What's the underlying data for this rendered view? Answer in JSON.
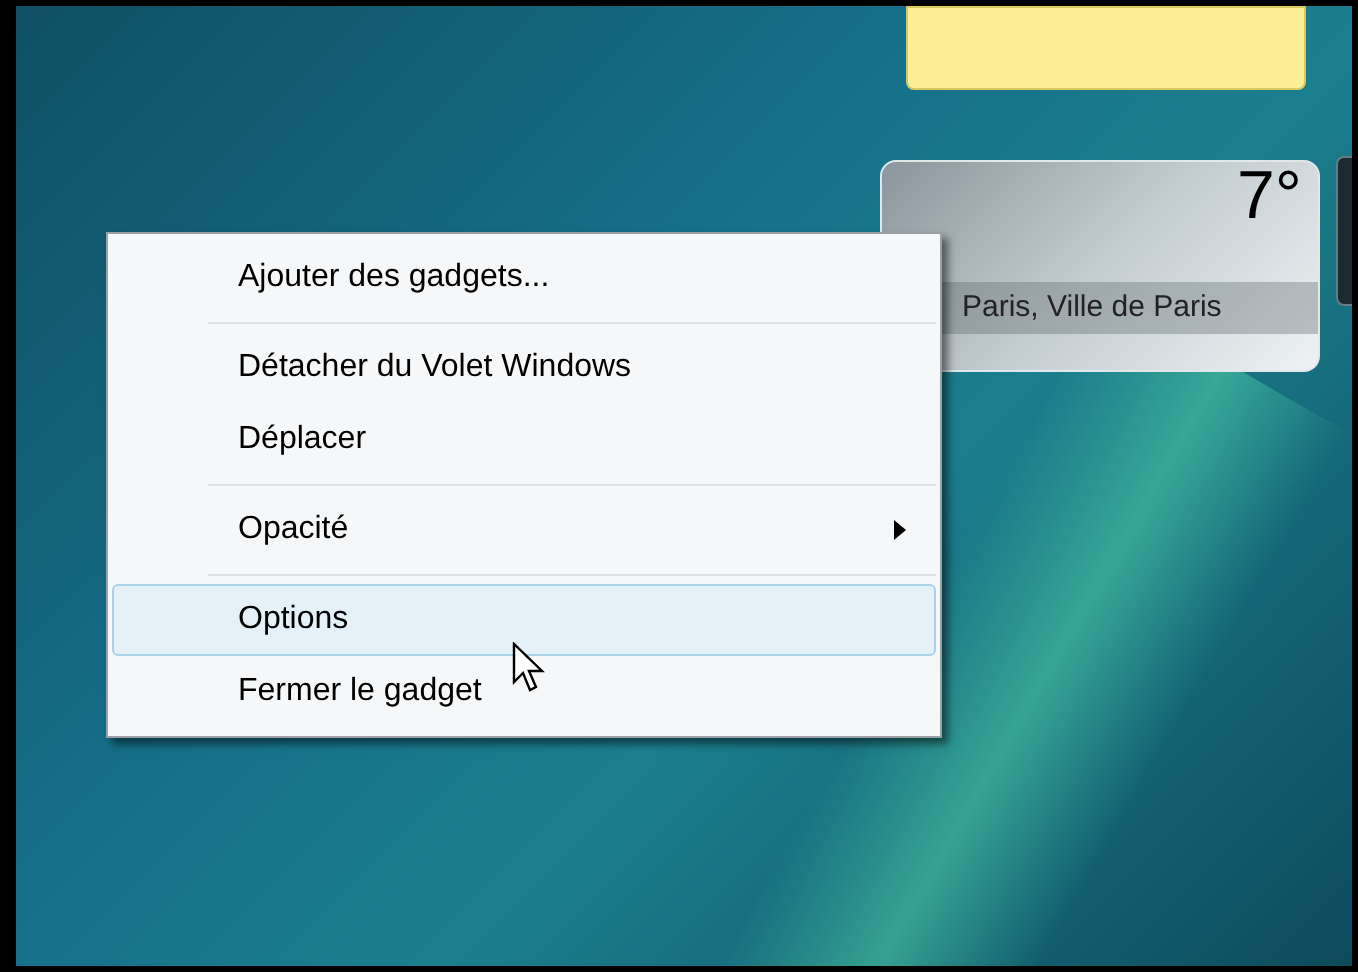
{
  "weather_gadget": {
    "temperature": "7°",
    "location": "Paris, Ville de Paris"
  },
  "context_menu": {
    "groups": [
      [
        {
          "label": "Ajouter des gadgets...",
          "selected": false,
          "has_submenu": false
        }
      ],
      [
        {
          "label": "Détacher du Volet Windows",
          "selected": false,
          "has_submenu": false
        },
        {
          "label": "Déplacer",
          "selected": false,
          "has_submenu": false
        }
      ],
      [
        {
          "label": "Opacité",
          "selected": false,
          "has_submenu": true
        }
      ],
      [
        {
          "label": "Options",
          "selected": true,
          "has_submenu": false
        },
        {
          "label": "Fermer le gadget",
          "selected": false,
          "has_submenu": false
        }
      ]
    ]
  }
}
